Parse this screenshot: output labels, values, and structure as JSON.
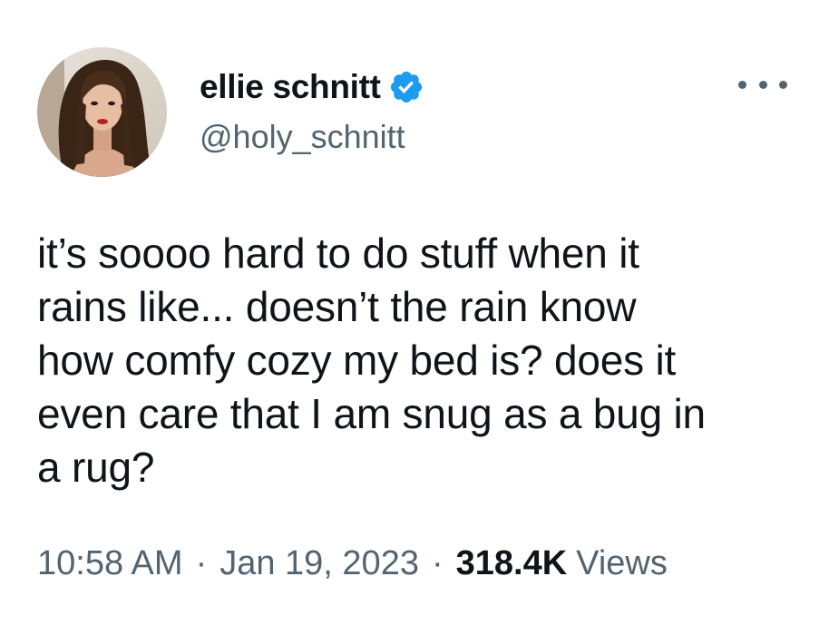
{
  "author": {
    "display_name": "ellie schnitt",
    "handle": "@holy_schnitt",
    "verified": true,
    "avatar_icon": "profile-photo"
  },
  "tweet": {
    "text": "it’s soooo hard to do stuff when it\nrains like... doesn’t the rain know\nhow comfy cozy my bed is? does it\neven care that I am snug as a bug in\na rug?"
  },
  "meta": {
    "time": "10:58 AM",
    "separator": "·",
    "date": "Jan 19, 2023",
    "views_count": "318.4K",
    "views_label": "Views"
  },
  "colors": {
    "text_primary": "#0f1419",
    "text_secondary": "#536471",
    "verified_blue": "#1d9bf0"
  },
  "icons": {
    "more": "more-horizontal-icon",
    "verified": "verified-badge-icon"
  }
}
